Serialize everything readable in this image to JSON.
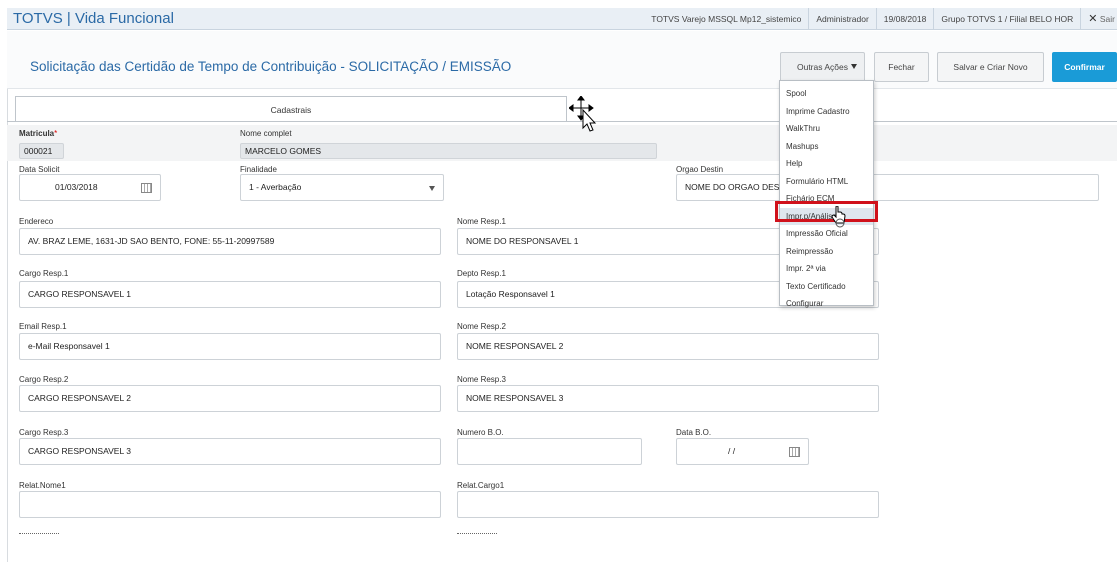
{
  "app": {
    "title": "TOTVS | Vida Funcional",
    "environment": "TOTVS Varejo MSSQL Mp12_sistemico",
    "user": "Administrador",
    "date": "19/08/2018",
    "branch": "Grupo TOTVS 1 / Filial BELO HOR",
    "close_glyph": "✕",
    "logout_label": "Sair"
  },
  "header": {
    "title": "Solicitação das Certidão de Tempo de Contribuição - SOLICITAÇÃO / EMISSÃO",
    "buttons": {
      "outras": "Outras Ações",
      "fechar": "Fechar",
      "salvar": "Salvar e Criar Novo",
      "confirmar": "Confirmar"
    },
    "accent_color": "#1a9bd7"
  },
  "tabs": {
    "cadastrais": "Cadastrais"
  },
  "record": {
    "matricula_label": "Matricula",
    "required_mark": "*",
    "matricula_value": "000021",
    "nome_label": "Nome complet",
    "nome_value": "MARCELO GOMES"
  },
  "form": {
    "data_solicit": {
      "label": "Data Solicit",
      "value": "01/03/2018"
    },
    "finalidade": {
      "label": "Finalidade",
      "value": "1 - Averbação"
    },
    "orgao_destin": {
      "label": "Orgao Destin",
      "value": "NOME DO ORGAO DESTI"
    },
    "endereco": {
      "label": "Endereco",
      "value": "AV. BRAZ LEME, 1631-JD SAO BENTO, FONE: 55-11-20997589"
    },
    "nome_resp1": {
      "label": "Nome Resp.1",
      "value": "NOME DO RESPONSAVEL 1"
    },
    "cargo_resp1": {
      "label": "Cargo Resp.1",
      "value": "CARGO RESPONSAVEL 1"
    },
    "depto_resp1": {
      "label": "Depto Resp.1",
      "value": "Lotação Responsavel 1"
    },
    "email_resp1": {
      "label": "Email Resp.1",
      "value": "e-Mail Responsavel 1"
    },
    "nome_resp2": {
      "label": "Nome Resp.2",
      "value": "NOME RESPONSAVEL 2"
    },
    "cargo_resp2": {
      "label": "Cargo Resp.2",
      "value": "CARGO RESPONSAVEL 2"
    },
    "nome_resp3": {
      "label": "Nome Resp.3",
      "value": "NOME RESPONSAVEL 3"
    },
    "cargo_resp3": {
      "label": "Cargo Resp.3",
      "value": "CARGO RESPONSAVEL 3"
    },
    "numero_bo": {
      "label": "Numero B.O.",
      "value": ""
    },
    "data_bo": {
      "label": "Data B.O.",
      "value": "/ /"
    },
    "relat_nome1": {
      "label": "Relat.Nome1",
      "value": ""
    },
    "relat_cargo1": {
      "label": "Relat.Cargo1",
      "value": ""
    }
  },
  "menu": {
    "items": [
      "Spool",
      "Imprime Cadastro",
      "WalkThru",
      "Mashups",
      "Help",
      "Formulário HTML",
      "Fichário ECM",
      "Impr.p/Análise",
      "Impressão Oficial",
      "Reimpressão",
      "Impr. 2ª via",
      "Texto Certificado",
      "Configurar"
    ],
    "highlighted_index": 7,
    "highlight_color": "#d0111b"
  }
}
